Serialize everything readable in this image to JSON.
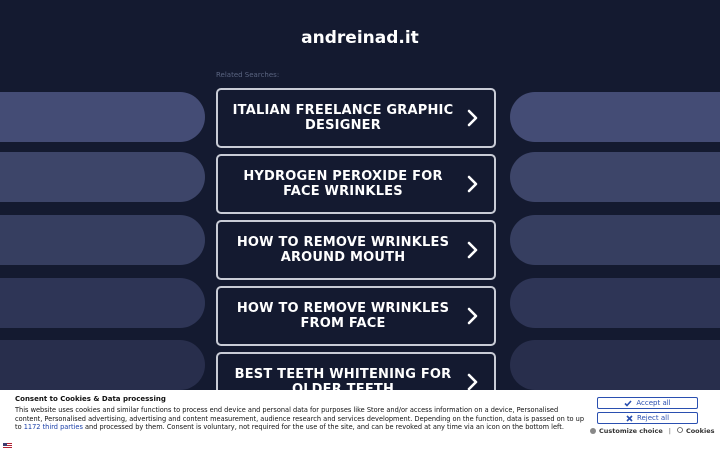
{
  "site": {
    "title": "andreinad.it"
  },
  "related": {
    "label": "Related Searches:",
    "items": [
      {
        "label": "ITALIAN FREELANCE GRAPHIC DESIGNER"
      },
      {
        "label": "HYDROGEN PEROXIDE FOR FACE WRINKLES"
      },
      {
        "label": "HOW TO REMOVE WRINKLES AROUND MOUTH"
      },
      {
        "label": "HOW TO REMOVE WRINKLES FROM FACE"
      },
      {
        "label": "BEST TEETH WHITENING FOR OLDER TEETH"
      }
    ]
  },
  "consent": {
    "title": "Consent to Cookies & Data processing",
    "body_before": "This website uses cookies and similar functions to process end device and personal data for purposes like Store and/or access information on a device, Personalised content, Personalised advertising, advertising and content measurement, audience research and services development. Depending on the function, data is passed on to up to ",
    "link": "1172 third parties",
    "body_after": " and processed by them. Consent is voluntary, not required for the use of the site, and can be revoked at any time via an icon on the bottom left.",
    "accept_label": "Accept all",
    "reject_label": "Reject all",
    "customize_label": "Customize choice",
    "separator": "|",
    "cookies_label": "Cookies"
  },
  "colors": {
    "background": "#141a30",
    "link_border": "#c9ccd6",
    "accent": "#2a4fb0"
  }
}
